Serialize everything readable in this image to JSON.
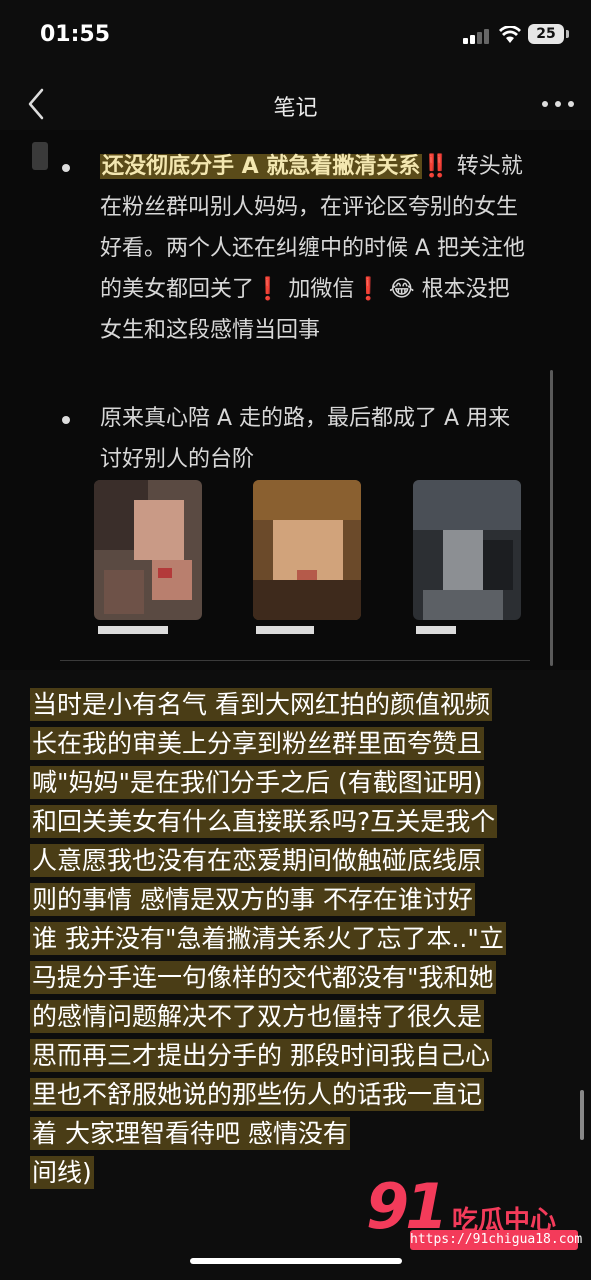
{
  "status": {
    "time": "01:55",
    "battery": "25"
  },
  "nav": {
    "title": "笔记"
  },
  "post": {
    "item1_title": "还没彻底分手 A 就急着撇清关系",
    "item1_mark1": "‼️",
    "item1_a": "转头就在粉丝群叫别人妈妈，在评论区夸别的女生好看。两个人还在纠缠中的时候 A 把关注他的美女都回关了",
    "item1_mark2": "❗",
    "item1_b": "加微信",
    "item1_mark3": "❗",
    "item1_emoji": "😂",
    "item1_c": "根本没把女生和这段感情当回事",
    "item2": "原来真心陪 A 走的路，最后都成了 A 用来讨好别人的台阶"
  },
  "reply": {
    "lines": [
      "当时是小有名气 看到大网红拍的颜值视频",
      "长在我的审美上分享到粉丝群里面夸赞且",
      "喊\"妈妈\"是在我们分手之后 (有截图证明)",
      "和回关美女有什么直接联系吗?互关是我个",
      "人意愿我也没有在恋爱期间做触碰底线原",
      "则的事情 感情是双方的事 不存在谁讨好",
      "谁 我并没有\"急着撇清关系火了忘了本..\"立",
      "马提分手连一句像样的交代都没有\"我和她",
      "的感情问题解决不了双方也僵持了很久是",
      "思而再三才提出分手的 那段时间我自己心",
      "里也不舒服她说的那些伤人的话我一直记",
      "着 大家理智看待吧 感情没有",
      "间线)"
    ]
  },
  "watermark": {
    "number": "91",
    "brand": "吃瓜中心",
    "url": "https://91chigua18.com"
  },
  "colors": {
    "highlight": "#4a3d16",
    "title_highlight": "#5a4b19",
    "watermark": "#f33b5a"
  }
}
